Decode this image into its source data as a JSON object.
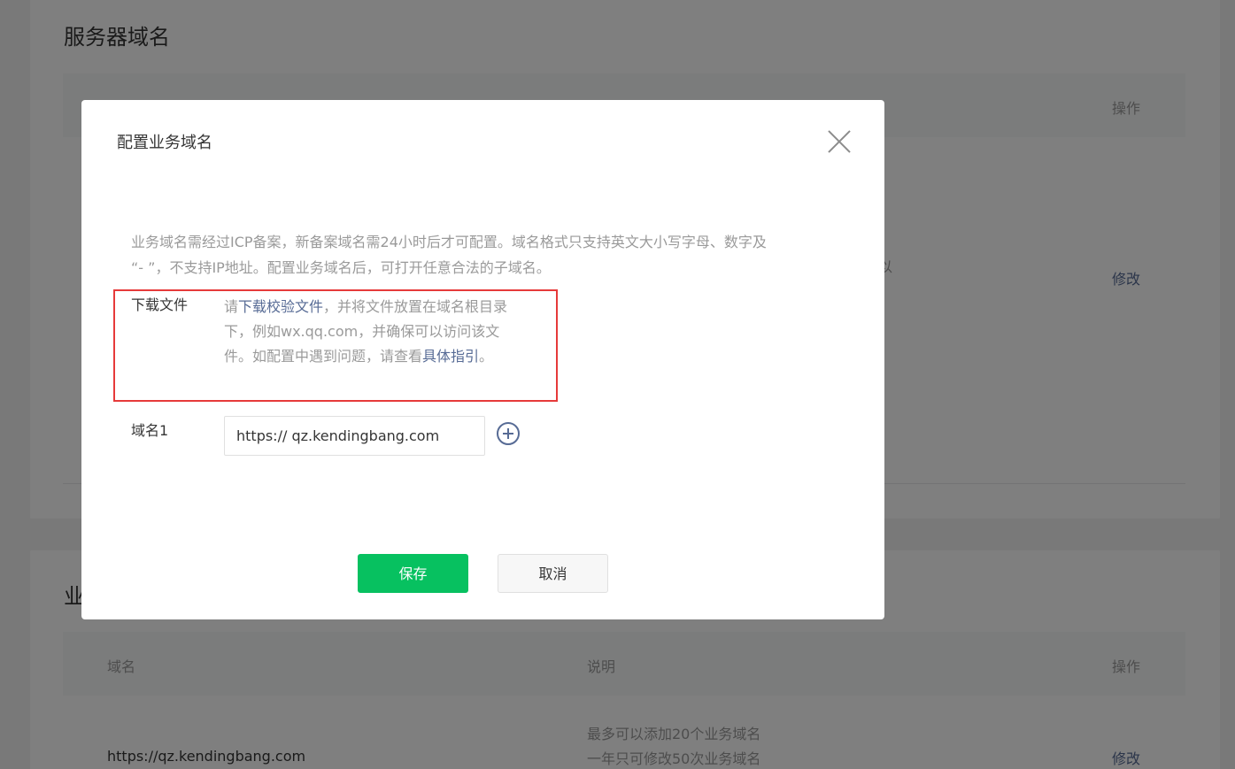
{
  "server_domains": {
    "title": "服务器域名",
    "columns": {
      "action": "操作"
    },
    "edit_link": "修改",
    "partial_text": "以"
  },
  "business_domains": {
    "title_partial": "业",
    "columns": {
      "domain": "域名",
      "description": "说明",
      "action": "操作"
    },
    "rows": [
      {
        "domain": "https://qz.kendingbang.com",
        "desc_line1": "最多可以添加20个业务域名",
        "desc_line2": "一年只可修改50次业务域名",
        "action": "修改"
      }
    ]
  },
  "dialog": {
    "title": "配置业务域名",
    "notice_line1": "业务域名需经过ICP备案，新备案域名需24小时后才可配置。域名格式只支持英文大小写字母、数字及",
    "notice_line2": "“- ”，不支持IP地址。配置业务域名后，可打开任意合法的子域名。",
    "download": {
      "label": "下载文件",
      "prefix": "请",
      "link1": "下载校验文件",
      "middle": "，并将文件放置在域名根目录下，例如wx.qq.com，并确保可以访问该文件。如配置中遇到问题，请查看",
      "link2": "具体指引",
      "suffix": "。"
    },
    "domain_field": {
      "label": "域名1",
      "value": "https:// qz.kendingbang.com"
    },
    "save_label": "保存",
    "cancel_label": "取消"
  },
  "colors": {
    "primary": "#07c160",
    "link": "#576b95",
    "highlight": "#e63a3a"
  }
}
